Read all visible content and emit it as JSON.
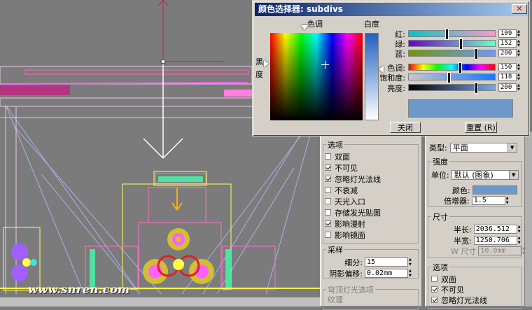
{
  "dialog": {
    "title": "颜色选择器: subdivs",
    "hue_label": "色调",
    "whiteness_label": "白度",
    "blackness_label_1": "黑",
    "blackness_label_2": "度",
    "channels": [
      {
        "label": "红:",
        "value": "109",
        "gradient": "linear-gradient(90deg,#00c8c8,#ff98c8)"
      },
      {
        "label": "绿:",
        "value": "152",
        "gradient": "linear-gradient(90deg,#6c00c8,#6cffc8)"
      },
      {
        "label": "蓝:",
        "value": "200",
        "gradient": "linear-gradient(90deg,#6d9800,#6d98ff)"
      },
      {
        "label": "色调:",
        "value": "150",
        "gradient": "linear-gradient(90deg,#ff0000,#ffff00,#00ff00,#00ffff,#0000ff,#ff00ff,#ff0000)"
      },
      {
        "label": "饱和度:",
        "value": "118",
        "gradient": "linear-gradient(90deg,#c8c8c8,#1878ff)"
      },
      {
        "label": "亮度:",
        "value": "200",
        "gradient": "linear-gradient(90deg,#000000,#78a8e8)"
      }
    ],
    "channel_fractions": [
      0.43,
      0.6,
      0.78,
      0.59,
      0.46,
      0.78
    ],
    "swatch_color": "#6d98c8",
    "close_button": "关闭",
    "reset_button": "重置 (R)"
  },
  "middle_panel": {
    "options_title": "选项",
    "checkboxes": [
      {
        "label": "双面",
        "checked": false
      },
      {
        "label": "不可见",
        "checked": true
      },
      {
        "label": "忽略灯光法线",
        "checked": true
      },
      {
        "label": "不衰减",
        "checked": false
      },
      {
        "label": "天光入口",
        "checked": false
      },
      {
        "label": "存储发光贴图",
        "checked": false
      },
      {
        "label": "影响漫射",
        "checked": true
      },
      {
        "label": "影响镜面",
        "checked": false
      }
    ],
    "sampling_title": "采样",
    "subdivs_label": "细分:",
    "subdivs_value": "15",
    "shadow_bias_label": "阴影偏移:",
    "shadow_bias_value": "0.02mm",
    "dome_title": "穹顶灯光选项",
    "texture_label": "纹理"
  },
  "right_panel": {
    "type_label": "类型:",
    "type_value": "平面",
    "intensity_title": "强度",
    "units_label": "单位:",
    "units_value": "默认 (图象)",
    "color_label": "颜色:",
    "color_value": "#6d98c8",
    "multiplier_label": "倍增器:",
    "multiplier_value": "1.5",
    "size_title": "尺寸",
    "half_length_label": "半长:",
    "half_length_value": "2036.512",
    "half_width_label": "半宽:",
    "half_width_value": "1250.706",
    "w_size_label": "W 尺寸",
    "w_size_value": "10.0mm",
    "options_title": "选项",
    "checkboxes": [
      {
        "label": "双面",
        "checked": false
      },
      {
        "label": "不可见",
        "checked": true
      },
      {
        "label": "忽略灯光法线",
        "checked": true
      }
    ]
  },
  "watermark": "www.snren.com",
  "colors": {
    "viewport_bg": "#7b7b7b",
    "panel_bg": "#d4d0c8",
    "title_bar": "#0a246a"
  }
}
